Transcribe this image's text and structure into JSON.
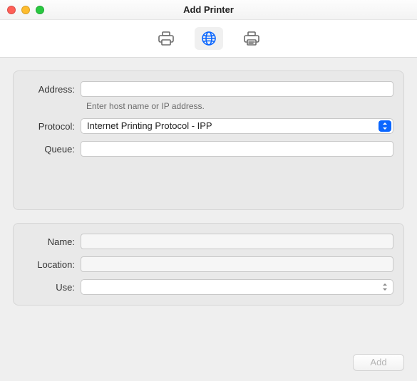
{
  "window": {
    "title": "Add Printer"
  },
  "toolbar": {
    "tabs": [
      {
        "name": "default-tab",
        "selected": false
      },
      {
        "name": "ip-tab",
        "selected": true
      },
      {
        "name": "windows-tab",
        "selected": false
      }
    ]
  },
  "form": {
    "address": {
      "label": "Address:",
      "value": "",
      "helper": "Enter host name or IP address."
    },
    "protocol": {
      "label": "Protocol:",
      "selected": "Internet Printing Protocol - IPP"
    },
    "queue": {
      "label": "Queue:",
      "value": ""
    },
    "name": {
      "label": "Name:",
      "value": ""
    },
    "location": {
      "label": "Location:",
      "value": ""
    },
    "use": {
      "label": "Use:",
      "selected": ""
    }
  },
  "footer": {
    "add_label": "Add"
  }
}
